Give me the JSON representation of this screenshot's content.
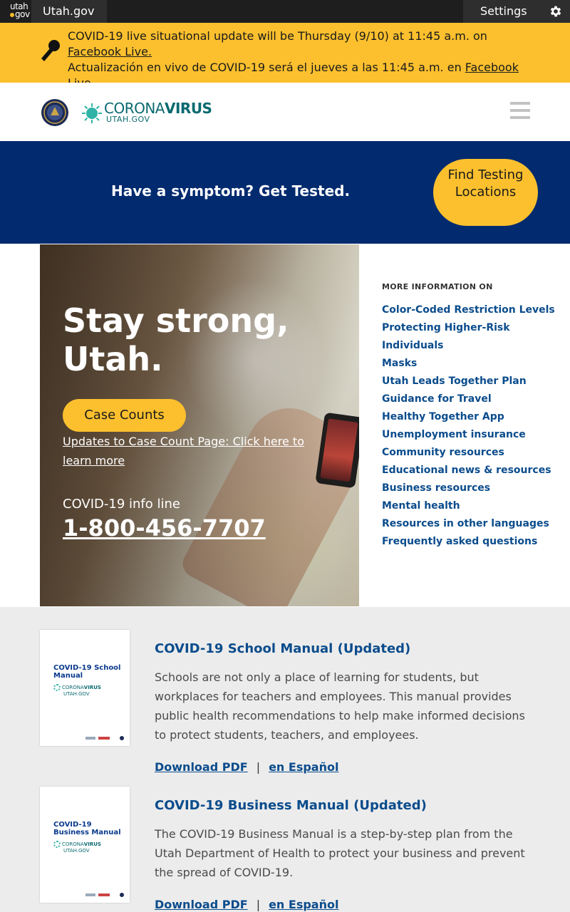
{
  "topbar": {
    "logo_top": "utah",
    "logo_bottom": "gov",
    "site_name": "Utah.gov",
    "settings_label": "Settings"
  },
  "alert": {
    "line1_prefix": "COVID-19 live situational update will be Thursday (9/10) at 11:45 a.m. on ",
    "line1_link": "Facebook Live.",
    "line2_prefix": "Actualización en vivo de COVID-19 será el jueves a las 11:45 a.m. en ",
    "line2_link": "Facebook Live."
  },
  "header": {
    "logo_word1": "CORONA",
    "logo_word2": "VIRUS",
    "logo_sub": "UTAH.GOV"
  },
  "symptom_band": {
    "message": "Have a symptom? Get Tested.",
    "button_label": "Find Testing Locations"
  },
  "hero": {
    "title": "Stay strong, Utah.",
    "case_button": "Case Counts",
    "update_link": "Updates to Case Count Page: Click here to learn more",
    "info_label": "COVID-19 info line",
    "info_phone": "1-800-456-7707"
  },
  "more_info": {
    "heading": "MORE INFORMATION ON",
    "links": [
      "Color-Coded Restriction Levels",
      "Protecting Higher-Risk Individuals",
      "Masks",
      "Utah Leads Together Plan",
      "Guidance for Travel",
      "Healthy Together App",
      "Unemployment insurance",
      "Community resources",
      "Educational news & resources",
      "Business resources",
      "Mental health",
      "Resources in other languages",
      "Frequently asked questions"
    ]
  },
  "cards": [
    {
      "thumb_title": "COVID-19 School Manual",
      "thumb_logo_word1": "CORONA",
      "thumb_logo_word2": "VIRUS",
      "thumb_logo_sub": "UTAH.GOV",
      "title": "COVID-19 School Manual (Updated)",
      "description": "Schools are not only a place of learning for students, but workplaces for teachers and employees. This manual provides public health recommendations to help make informed decisions to protect students, teachers, and employees.",
      "download_label": "Download PDF",
      "separator": "|",
      "spanish_label": "en Español"
    },
    {
      "thumb_title": "COVID-19 Business Manual",
      "thumb_logo_word1": "CORONA",
      "thumb_logo_word2": "VIRUS",
      "thumb_logo_sub": "UTAH.GOV",
      "title": "COVID-19 Business Manual (Updated)",
      "description": "The COVID-19 Business Manual is a step-by-step plan from the Utah Department of Health to protect your business and prevent the spread of COVID-19.",
      "download_label": "Download PDF",
      "separator": "|",
      "spanish_label": "en Español"
    }
  ],
  "colors": {
    "accent_yellow": "#fcc02e",
    "navy": "#022a6e",
    "link_blue": "#0b4c8c",
    "teal": "#0a6a70"
  }
}
